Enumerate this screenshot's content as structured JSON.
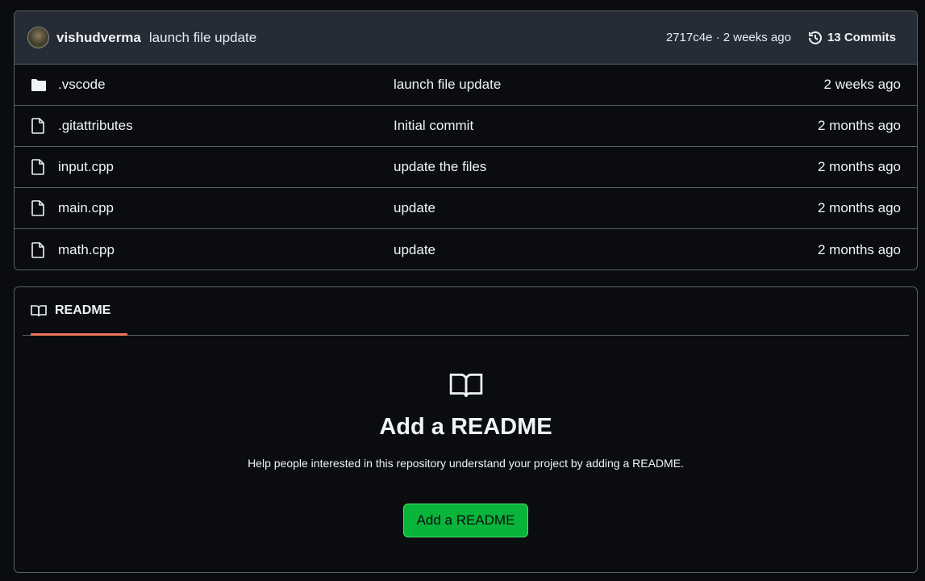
{
  "latest_commit": {
    "author": "vishudverma",
    "message": "launch file update",
    "sha": "2717c4e",
    "separator": "·",
    "time": "2 weeks ago",
    "commits_label": "13 Commits"
  },
  "files": [
    {
      "type": "folder",
      "name": ".vscode",
      "message": "launch file update",
      "time": "2 weeks ago"
    },
    {
      "type": "file",
      "name": ".gitattributes",
      "message": "Initial commit",
      "time": "2 months ago"
    },
    {
      "type": "file",
      "name": "input.cpp",
      "message": "update the files",
      "time": "2 months ago"
    },
    {
      "type": "file",
      "name": "main.cpp",
      "message": "update",
      "time": "2 months ago"
    },
    {
      "type": "file",
      "name": "math.cpp",
      "message": "update",
      "time": "2 months ago"
    }
  ],
  "readme": {
    "tab_label": "README",
    "title": "Add a README",
    "help": "Help people interested in this repository understand your project by adding a README.",
    "button": "Add a README"
  },
  "colors": {
    "accent_tab": "#ec775c",
    "button": "#09b43a"
  }
}
